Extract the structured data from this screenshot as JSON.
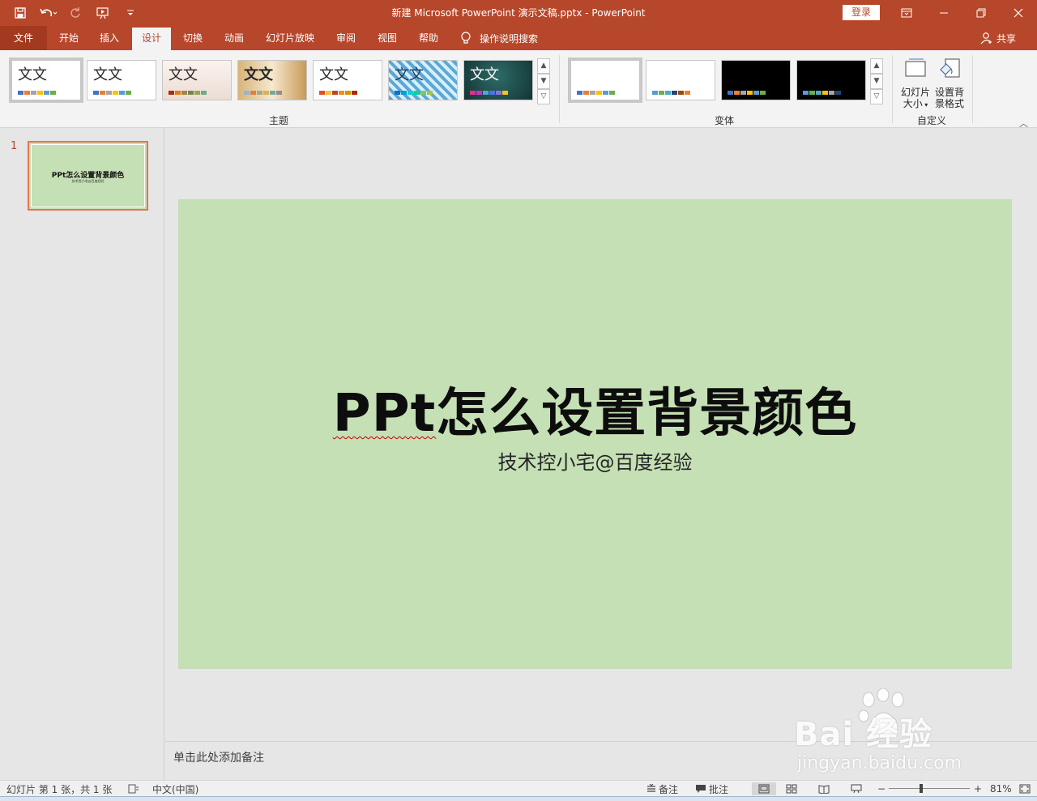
{
  "window": {
    "title": "新建 Microsoft PowerPoint 演示文稿.pptx  -  PowerPoint",
    "login_label": "登录",
    "accent_color": "#b7472a"
  },
  "tabs": [
    {
      "label": "文件"
    },
    {
      "label": "开始"
    },
    {
      "label": "插入"
    },
    {
      "label": "设计"
    },
    {
      "label": "切换"
    },
    {
      "label": "动画"
    },
    {
      "label": "幻灯片放映"
    },
    {
      "label": "审阅"
    },
    {
      "label": "视图"
    },
    {
      "label": "帮助"
    }
  ],
  "active_tab": "设计",
  "tell_me": "操作说明搜索",
  "share": "共享",
  "ribbon": {
    "themes_label": "主题",
    "variants_label": "变体",
    "customize_label": "自定义",
    "themes": [
      {
        "text": "文文"
      },
      {
        "text": "文文"
      },
      {
        "text": "文文"
      },
      {
        "text": "文文"
      },
      {
        "text": "文文"
      },
      {
        "text": "文文"
      },
      {
        "text": "文文"
      }
    ],
    "slide_size": {
      "line1": "幻灯片",
      "line2": "大小"
    },
    "format_bg": {
      "line1": "设置背",
      "line2": "景格式"
    }
  },
  "slides": {
    "number": "1",
    "thumb_title": "PPt怎么设置背景颜色",
    "thumb_subtitle": "技术控小宅@百度经验"
  },
  "slide": {
    "title_part1": "PPt",
    "title_part2": "怎么设置背景颜色",
    "subtitle": "技术控小宅@百度经验",
    "background_color": "#c5e0b4"
  },
  "notes_placeholder": "单击此处添加备注",
  "watermark": {
    "main": "Bai   经验",
    "sub": "jingyan.baidu.com"
  },
  "status": {
    "slide_info": "幻灯片 第 1 张，共 1 张",
    "language": "中文(中国)",
    "notes": "备注",
    "comments": "批注",
    "zoom": "81%"
  }
}
